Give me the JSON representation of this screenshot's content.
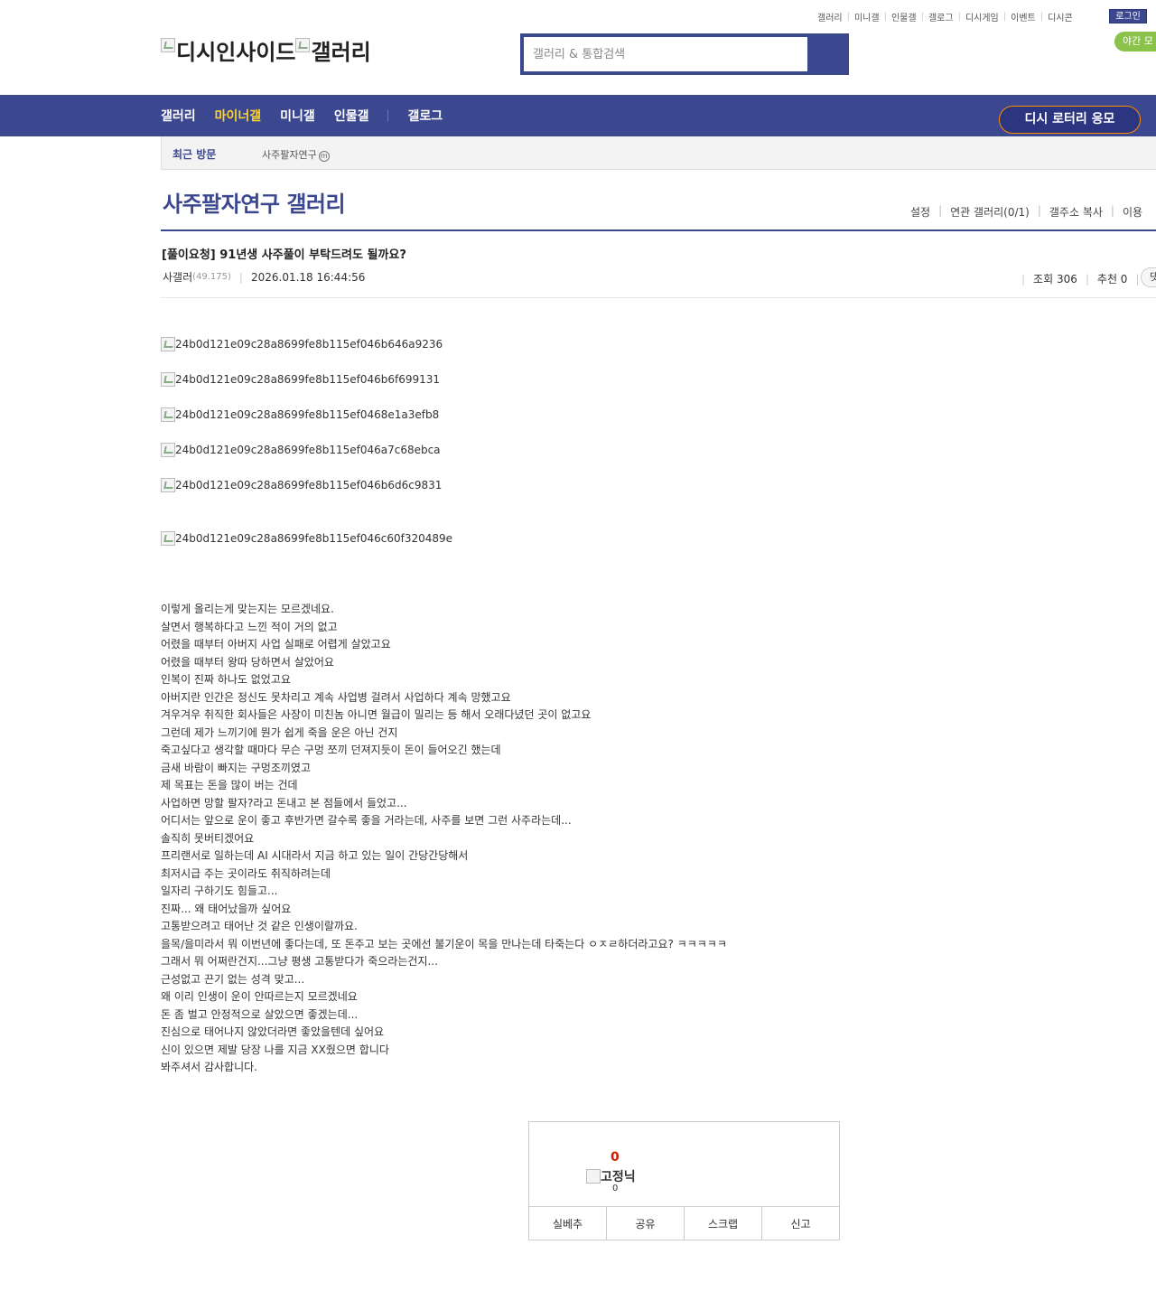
{
  "util": {
    "links": [
      "갤러리",
      "미니갤",
      "인물갤",
      "갤로그",
      "디시게임",
      "이벤트",
      "디시콘"
    ],
    "login": "로그인",
    "night": "야간 모"
  },
  "logo": {
    "site": "디시인사이드",
    "gallery": "갤러리"
  },
  "search": {
    "placeholder": "갤러리 & 통합검색"
  },
  "nav": {
    "items": [
      "갤러리",
      "마이너갤",
      "미니갤",
      "인물갤"
    ],
    "gallog": "갤로그",
    "lottery": "디시 로터리 응모"
  },
  "recent": {
    "label": "최근 방문",
    "item": "사주팔자연구",
    "badge": "m"
  },
  "gallery": {
    "title": "사주팔자연구 갤러리",
    "menu": [
      "설정",
      "연관 갤러리(0/1)",
      "갤주소 복사",
      "이용"
    ]
  },
  "post": {
    "title": "[풀이요청] 91년생 사주풀이 부탁드려도 될까요?",
    "author": "사갤러",
    "ip": "(49.175)",
    "date": "2026.01.18 16:44:56",
    "views": "조회 306",
    "recommend": "추천 0",
    "more": "댓",
    "images": [
      "24b0d121e09c28a8699fe8b115ef046b646a9236",
      "24b0d121e09c28a8699fe8b115ef046b6f699131",
      "24b0d121e09c28a8699fe8b115ef0468e1a3efb8",
      "24b0d121e09c28a8699fe8b115ef046a7c68ebca",
      "24b0d121e09c28a8699fe8b115ef046b6d6c9831",
      "24b0d121e09c28a8699fe8b115ef046c60f320489e"
    ],
    "body": [
      "이렇게 올리는게 맞는지는 모르겠네요.",
      "살면서 행복하다고 느낀 적이 거의 없고",
      "어렸을 때부터 아버지 사업 실패로 어렵게 살았고요",
      "어렸을 때부터 왕따 당하면서 살았어요",
      "인복이 진짜 하나도 없었고요",
      "아버지란 인간은 정신도 못차리고 계속 사업병 걸려서 사업하다 계속 망했고요",
      "겨우겨우 취직한 회사들은 사장이 미친놈 아니면 월급이 밀리는 등 해서 오래다녔던 곳이 없고요",
      "그런데 제가 느끼기에 뭔가 쉽게 죽을 운은 아닌 건지",
      "죽고싶다고 생각할 때마다 무슨 구멍 쪼끼 던져지듯이 돈이 들어오긴 했는데",
      "금새 바람이 빠지는 구멍조끼였고",
      "제 목표는 돈을 많이 버는 건데",
      "사업하면 망할 팔자?라고 돈내고 본 점들에서 들었고...",
      "어디서는 앞으로 운이 좋고 후반가면 갈수록 좋을 거라는데, 사주를 보면 그런 사주라는데...",
      "솔직히 못버티겠어요",
      "프리랜서로 일하는데 AI 시대라서 지금 하고 있는 일이 간당간당해서",
      "최저시급 주는 곳이라도 취직하려는데",
      "일자리 구하기도 힘들고...",
      "진짜... 왜 태어났을까 싶어요",
      "고통받으려고 태어난 것 같은 인생이랄까요.",
      "을목/을미라서 뭐 이번년에 좋다는데, 또 돈주고 보는 곳에선 불기운이 목을 만나는데 타죽는다 ㅇㅈㄹ하더라고요? ㅋㅋㅋㅋㅋ",
      "그래서 뭐 어쩌란건지...그냥 평생 고통받다가 죽으라는건지...",
      "근성없고 끈기 없는 성격 맞고...",
      "왜 이리 인생이 운이 안따르는지 모르겠네요",
      "돈 좀 벌고 안정적으로 살았으면 좋겠는데...",
      "진심으로 태어나지 않았더라면 좋았을텐데 싶어요",
      "신이 있으면 제발 당장 나를 지금 XX줬으면 합니다",
      "봐주셔서 감사합니다."
    ]
  },
  "recommend_box": {
    "count": "0",
    "fixed_label": "고정닉",
    "fixed_count": "0",
    "actions": [
      "실베추",
      "공유",
      "스크랩",
      "신고"
    ]
  }
}
